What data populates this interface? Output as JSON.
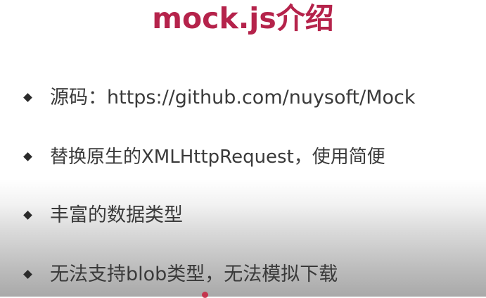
{
  "slide": {
    "title": "mock.js介绍",
    "bullets": [
      "源码：https://github.com/nuysoft/Mock",
      "替换原生的XMLHttpRequest，使用简便",
      "丰富的数据类型",
      "无法支持blob类型，无法模拟下载"
    ]
  },
  "colors": {
    "title": "#b5234b",
    "text": "#3a3a3a",
    "bullet": "#2b2b2b",
    "cursor": "#c81e3c"
  },
  "icons": {
    "bullet": "diamond-bullet-icon",
    "cursor": "pointer-dot-icon"
  }
}
